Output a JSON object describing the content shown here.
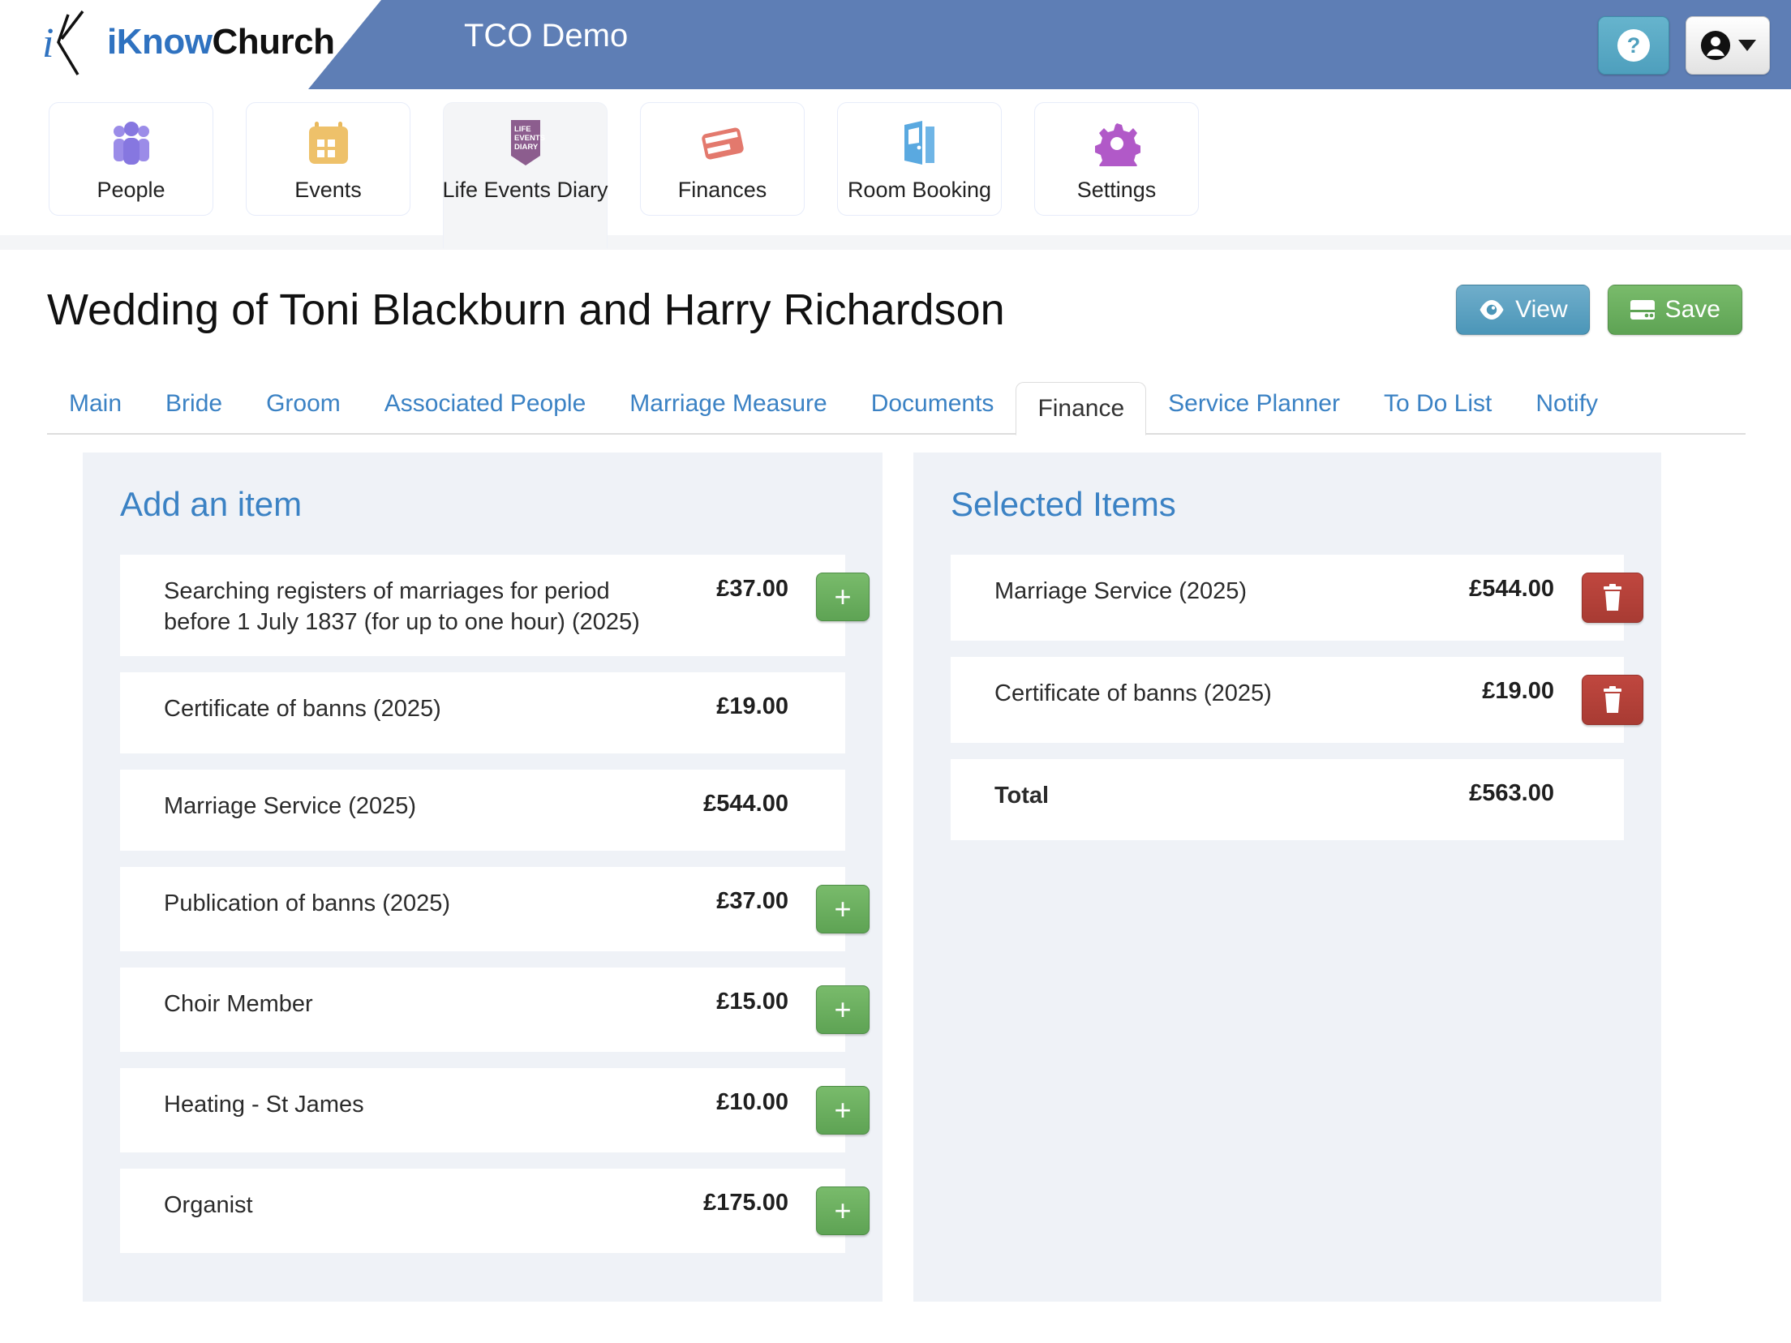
{
  "brand": {
    "name_part1": "iKnow",
    "name_part2": "Church",
    "logo_icon": "ikonwchurch-logo-icon"
  },
  "header": {
    "app_title": "TCO Demo",
    "help_label": "?",
    "help_icon": "question-mark-icon",
    "account_icon": "user-account-icon",
    "caret_icon": "chevron-down-icon",
    "brand_bar_color": "#5e7eb5"
  },
  "module_nav": {
    "items": [
      {
        "label": "People",
        "icon": "people-group-icon",
        "active": false
      },
      {
        "label": "Events",
        "icon": "calendar-icon",
        "active": false
      },
      {
        "label": "Life Events Diary",
        "icon": "life-events-diary-icon",
        "active": true
      },
      {
        "label": "Finances",
        "icon": "credit-card-icon",
        "active": false
      },
      {
        "label": "Room Booking",
        "icon": "open-door-icon",
        "active": false
      },
      {
        "label": "Settings",
        "icon": "gear-icon",
        "active": false
      }
    ]
  },
  "page": {
    "title": "Wedding of Toni Blackburn and Harry Richardson",
    "view_label": "View",
    "view_icon": "eye-icon",
    "save_label": "Save",
    "save_icon": "floppy-disk-icon"
  },
  "tabs": [
    {
      "label": "Main",
      "active": false
    },
    {
      "label": "Bride",
      "active": false
    },
    {
      "label": "Groom",
      "active": false
    },
    {
      "label": "Associated People",
      "active": false
    },
    {
      "label": "Marriage Measure",
      "active": false
    },
    {
      "label": "Documents",
      "active": false
    },
    {
      "label": "Finance",
      "active": true
    },
    {
      "label": "Service Planner",
      "active": false
    },
    {
      "label": "To Do List",
      "active": false
    },
    {
      "label": "Notify",
      "active": false
    }
  ],
  "add_panel": {
    "title": "Add an item",
    "add_icon": "plus-icon",
    "items": [
      {
        "name": "Searching registers of marriages for period before 1 July 1837 (for up to one hour) (2025)",
        "price": "£37.00",
        "has_add": true
      },
      {
        "name": "Certificate of banns (2025)",
        "price": "£19.00",
        "has_add": false
      },
      {
        "name": "Marriage Service (2025)",
        "price": "£544.00",
        "has_add": false
      },
      {
        "name": "Publication of banns (2025)",
        "price": "£37.00",
        "has_add": true
      },
      {
        "name": "Choir Member",
        "price": "£15.00",
        "has_add": true
      },
      {
        "name": "Heating - St James",
        "price": "£10.00",
        "has_add": true
      },
      {
        "name": "Organist",
        "price": "£175.00",
        "has_add": true
      }
    ]
  },
  "selected_panel": {
    "title": "Selected Items",
    "delete_icon": "trash-icon",
    "items": [
      {
        "name": "Marriage Service (2025)",
        "price": "£544.00"
      },
      {
        "name": "Certificate of banns (2025)",
        "price": "£19.00"
      }
    ],
    "total_label": "Total",
    "total_value": "£563.00"
  },
  "colors": {
    "brand_blue": "#2f72c0",
    "link_blue": "#3b82c4",
    "panel_bg": "#eff2f7",
    "add_green": "#5ea354",
    "delete_red": "#b04038",
    "header_blue": "#5e7eb5"
  }
}
